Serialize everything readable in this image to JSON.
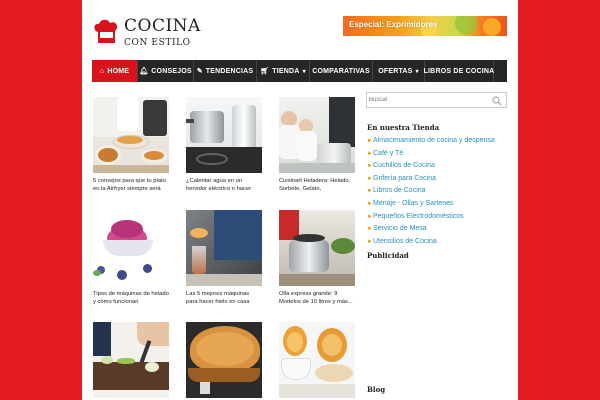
{
  "brand": {
    "line1": "COCINA",
    "line2": "CON ESTILO",
    "logo_icon": "chef-hat-icon",
    "accent": "#d7141c"
  },
  "banner": {
    "text": "Especial: Exprimidores"
  },
  "nav": {
    "items": [
      {
        "label": "HOME",
        "icon": "home-icon",
        "active": true
      },
      {
        "label": "CONSEJOS",
        "icon": "bell-icon"
      },
      {
        "label": "TENDENCIAS",
        "icon": "pencil-icon"
      },
      {
        "label": "TIENDA",
        "icon": "cart-icon",
        "dropdown": true
      },
      {
        "label": "COMPARATIVAS"
      },
      {
        "label": "OFERTAS",
        "dropdown": true
      },
      {
        "label": "LIBROS DE COCINA"
      }
    ]
  },
  "articles": [
    {
      "caption": "5 consejos para que tu plato en la Airfryer siempre será"
    },
    {
      "caption": "¿Calentar agua en un hervidor eléctrico o hacer"
    },
    {
      "caption": "Cuisinart Heladera: Helado, Sorbete, Gelato,"
    },
    {
      "caption": "Tipos de máquinas de helado y cómo funcionan"
    },
    {
      "caption": "Las 5 mejores máquinas para hacer hielo en casa"
    },
    {
      "caption": "Olla express grande: 9 Modelos de 10 litros y más..."
    },
    {
      "caption": ""
    },
    {
      "caption": ""
    },
    {
      "caption": ""
    }
  ],
  "sidebar": {
    "search_placeholder": "Buscar",
    "store_title": "En nuestra Tienda",
    "categories": [
      "Almacenamiento de cocina y despensa",
      "Café y Té",
      "Cuchillos de Cocina",
      "Grifería para Cocina",
      "Libros de Cocina",
      "Menaje - Ollas y Sartenes",
      "Pequeños Electrodomésticos",
      "Servicio de Mesa",
      "Utensilios de Cocina"
    ],
    "publicidad_title": "Publicidad",
    "blog_title": "Blog"
  }
}
